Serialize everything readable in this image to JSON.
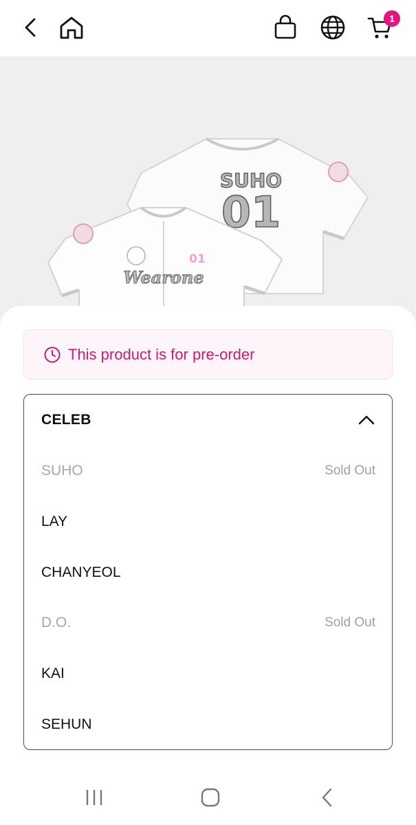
{
  "header": {
    "back_icon": "chevron-left-icon",
    "home_icon": "home-icon",
    "bag_icon": "shopping-bag-icon",
    "language_icon": "globe-icon",
    "cart_icon": "cart-icon",
    "cart_count": "1",
    "accent_color": "#e5157e"
  },
  "product_image": {
    "back_jersey": {
      "name": "SUHO",
      "number": "01"
    },
    "front_jersey": {
      "number": "01",
      "script": "Wearone"
    }
  },
  "notice": {
    "icon": "clock-icon",
    "text": "This product is for pre-order",
    "color": "#c81a78"
  },
  "dropdown": {
    "title": "CELEB",
    "expanded": true,
    "chevron_icon": "chevron-up-icon",
    "options": [
      {
        "label": "SUHO",
        "status": "Sold Out",
        "disabled": true
      },
      {
        "label": "LAY",
        "status": "",
        "disabled": false
      },
      {
        "label": "CHANYEOL",
        "status": "",
        "disabled": false
      },
      {
        "label": "D.O.",
        "status": "Sold Out",
        "disabled": true
      },
      {
        "label": "KAI",
        "status": "",
        "disabled": false
      },
      {
        "label": "SEHUN",
        "status": "",
        "disabled": false
      }
    ]
  },
  "system_nav": {
    "recents_icon": "recents-icon",
    "home_icon": "circle-home-icon",
    "back_icon": "back-arrow-icon"
  }
}
